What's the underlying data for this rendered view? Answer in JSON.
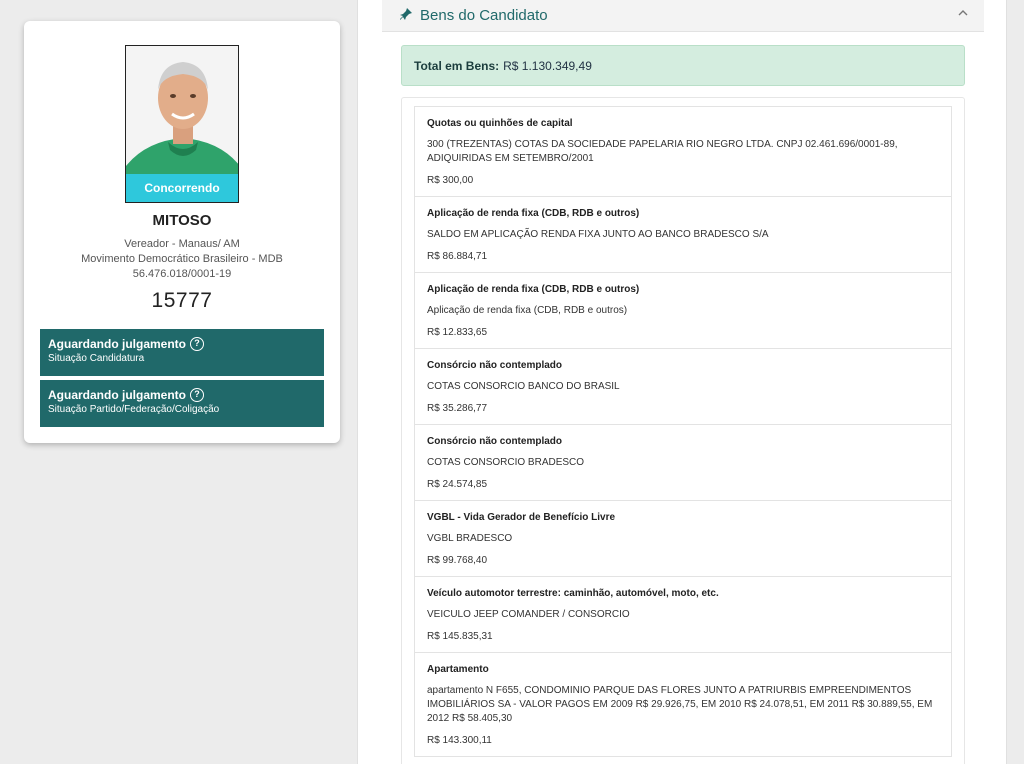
{
  "candidate": {
    "photo_badge": "Concorrendo",
    "name": "MITOSO",
    "office": "Vereador - Manaus/ AM",
    "party": "Movimento Democrático Brasileiro - MDB",
    "cnpj": "56.476.018/0001-19",
    "number": "15777",
    "status": [
      {
        "title": "Aguardando julgamento",
        "subtitle": "Situação Candidatura"
      },
      {
        "title": "Aguardando julgamento",
        "subtitle": "Situação Partido/Federação/Coligação"
      }
    ]
  },
  "assets": {
    "section_title": "Bens do Candidato",
    "total_label": "Total em Bens:",
    "total_value": "R$ 1.130.349,49",
    "items": [
      {
        "title": "Quotas ou quinhões de capital",
        "description": "300 (TREZENTAS) COTAS DA SOCIEDADE PAPELARIA RIO NEGRO LTDA. CNPJ 02.461.696/0001-89, ADIQUIRIDAS EM SETEMBRO/2001",
        "value": "R$ 300,00"
      },
      {
        "title": "Aplicação de renda fixa (CDB, RDB e outros)",
        "description": "SALDO EM APLICAÇÃO RENDA FIXA JUNTO AO BANCO BRADESCO S/A",
        "value": "R$ 86.884,71"
      },
      {
        "title": "Aplicação de renda fixa (CDB, RDB e outros)",
        "description": "Aplicação de renda fixa (CDB, RDB e outros)",
        "value": "R$ 12.833,65"
      },
      {
        "title": "Consórcio não contemplado",
        "description": "COTAS CONSORCIO BANCO DO BRASIL",
        "value": "R$ 35.286,77"
      },
      {
        "title": "Consórcio não contemplado",
        "description": "COTAS CONSORCIO BRADESCO",
        "value": "R$ 24.574,85"
      },
      {
        "title": "VGBL - Vida Gerador de Benefício Livre",
        "description": "VGBL BRADESCO",
        "value": "R$ 99.768,40"
      },
      {
        "title": "Veículo automotor terrestre: caminhão, automóvel, moto, etc.",
        "description": "VEICULO JEEP COMANDER / CONSORCIO",
        "value": "R$ 145.835,31"
      },
      {
        "title": "Apartamento",
        "description": "apartamento N F655, CONDOMINIO PARQUE DAS FLORES JUNTO A PATRIURBIS EMPREENDIMENTOS IMOBILIÁRIOS SA - VALOR PAGOS EM 2009 R$ 29.926,75, EM 2010 R$ 24.078,51, EM 2011 R$ 30.889,55, EM 2012 R$ 58.405,30",
        "value": "R$ 143.300,11"
      }
    ]
  },
  "icons": {
    "section": "pin-icon",
    "collapse": "chevron-up-icon",
    "help": "help-circle-icon"
  },
  "colors": {
    "accent": "#20696a",
    "badge": "#2ec8dc",
    "total_bg": "#d4eddf"
  }
}
